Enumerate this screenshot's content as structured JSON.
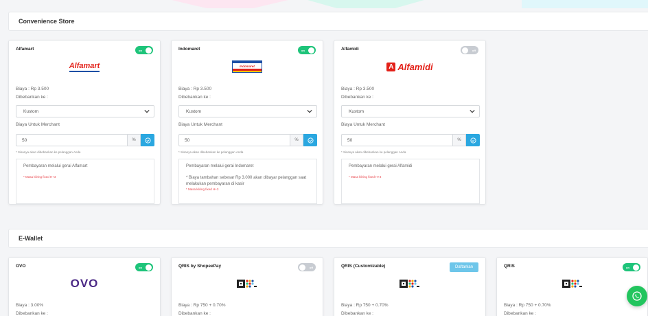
{
  "sections": {
    "convenience": "Convenience Store",
    "ewallet": "E-Wallet"
  },
  "stores": [
    {
      "name": "Alfamart",
      "toggle_label": "on",
      "enabled": true,
      "logo_text": "Alfamart",
      "fee": "Biaya : Rp 3.500",
      "charged_to": "Dibebankan ke :",
      "select_value": "Kustom",
      "merchant_fee_label": "Biaya Untuk Merchant",
      "merchant_fee_value": "50",
      "percent": "%",
      "note": "* Sisanya akan dibebankan ke pelanggan Anda",
      "info": "Pembayaran melalui gerai Alfamart",
      "extra": "",
      "settlement": "* Masa kliring fixed H+3"
    },
    {
      "name": "Indomaret",
      "toggle_label": "on",
      "enabled": true,
      "logo_text": "Indomaret",
      "fee": "Biaya : Rp 3.500",
      "charged_to": "Dibebankan ke :",
      "select_value": "Kustom",
      "merchant_fee_label": "Biaya Untuk Merchant",
      "merchant_fee_value": "50",
      "percent": "%",
      "note": "* Sisanya akan dibebankan ke pelanggan Anda",
      "info": "Pembayaran melalui gerai Indomaret",
      "extra": "* Biaya tambahan sebesar Rp 3.000 akan dibayar pelanggan saat melakukan pembayaran di kasir",
      "settlement": "* Masa kliring fixed H+3"
    },
    {
      "name": "Alfamidi",
      "toggle_label": "off",
      "enabled": false,
      "logo_text": "Alfamidi",
      "fee": "Biaya : Rp 3.500",
      "charged_to": "Dibebankan ke :",
      "select_value": "Kustom",
      "merchant_fee_label": "Biaya Untuk Merchant",
      "merchant_fee_value": "50",
      "percent": "%",
      "note": "* Sisanya akan dibebankan ke pelanggan Anda",
      "info": "Pembayaran melalui gerai Alfamidi",
      "extra": "",
      "settlement": "* Masa kliring fixed H+3"
    }
  ],
  "wallets": [
    {
      "name": "OVO",
      "control": "toggle",
      "toggle_label": "on",
      "enabled": true,
      "logo_text": "OVO",
      "fee": "Biaya : 3.00%",
      "charged_to": "Dibebankan ke :"
    },
    {
      "name": "QRIS by ShopeePay",
      "control": "toggle",
      "toggle_label": "off",
      "enabled": false,
      "logo_text": "QRIS",
      "fee": "Biaya : Rp 750 + 0.70%",
      "charged_to": "Dibebankan ke :"
    },
    {
      "name": "QRIS (Customizable)",
      "control": "button",
      "button_label": "Daftarkan",
      "logo_text": "QRIS",
      "fee": "Biaya : Rp 750 + 0.70%",
      "charged_to": "Dibebankan ke :"
    },
    {
      "name": "QRIS",
      "control": "toggle",
      "toggle_label": "on",
      "enabled": true,
      "logo_text": "QRIS",
      "fee": "Biaya : Rp 750 + 0.70%",
      "charged_to": "Dibebankan ke :"
    }
  ],
  "colors": {
    "toggle_on": "#1ec47a",
    "toggle_off": "#c8ccd2",
    "accent": "#2aa7e0",
    "alfa_red": "#e32119",
    "ovo_purple": "#4c2a86",
    "whatsapp": "#22c55e"
  },
  "icons": {
    "whatsapp": "whatsapp-icon",
    "check": "check-circle-icon",
    "chevron": "chevron-down-icon"
  }
}
